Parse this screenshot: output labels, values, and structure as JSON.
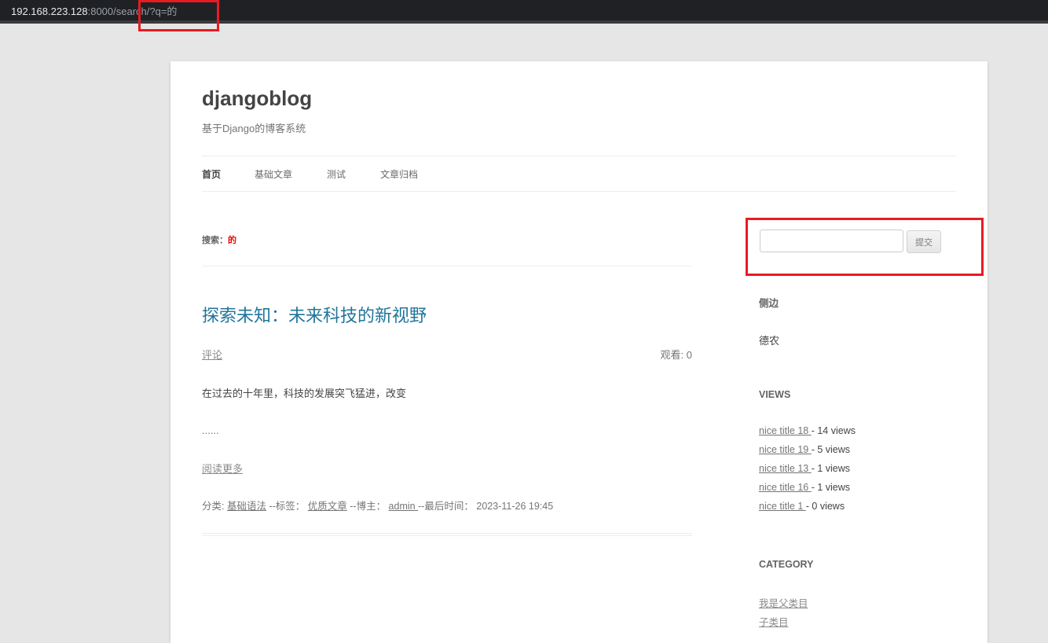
{
  "browser": {
    "url_host": "192.168.223.128",
    "url_path": ":8000/search/?q=的"
  },
  "site": {
    "title": "djangoblog",
    "description": "基于Django的博客系统"
  },
  "nav": {
    "items": [
      "首页",
      "基础文章",
      "测试",
      "文章归档"
    ]
  },
  "search": {
    "label": "搜索：",
    "term": "的",
    "input_value": "",
    "submit_label": "提交"
  },
  "article": {
    "title": "探索未知：未来科技的新视野",
    "comments_label": "评论",
    "views_label": "观看: 0",
    "excerpt": "在过去的十年里，科技的发展突飞猛进，改变",
    "ellipsis": "......",
    "read_more": "阅读更多",
    "meta": {
      "category_label": "分类: ",
      "category": "基础语法",
      "tag_label": " --标签： ",
      "tag": "优质文章",
      "author_label": " --博主： ",
      "author": "admin ",
      "time_label": "--最后时间： ",
      "time": "2023-11-26 19:45"
    }
  },
  "sidebar": {
    "side_title": "侧边",
    "side_text": "德农",
    "views_title": "VIEWS",
    "views": [
      {
        "title": "nice title 18 ",
        "count": " - 14 views"
      },
      {
        "title": "nice title 19 ",
        "count": " - 5 views"
      },
      {
        "title": "nice title 13 ",
        "count": " - 1 views"
      },
      {
        "title": "nice title 16 ",
        "count": " - 1 views"
      },
      {
        "title": "nice title 1 ",
        "count": " - 0 views"
      }
    ],
    "category_title": "CATEGORY",
    "categories": [
      "我是父类目",
      "子类目"
    ]
  },
  "annotation_color": "#e81b23"
}
